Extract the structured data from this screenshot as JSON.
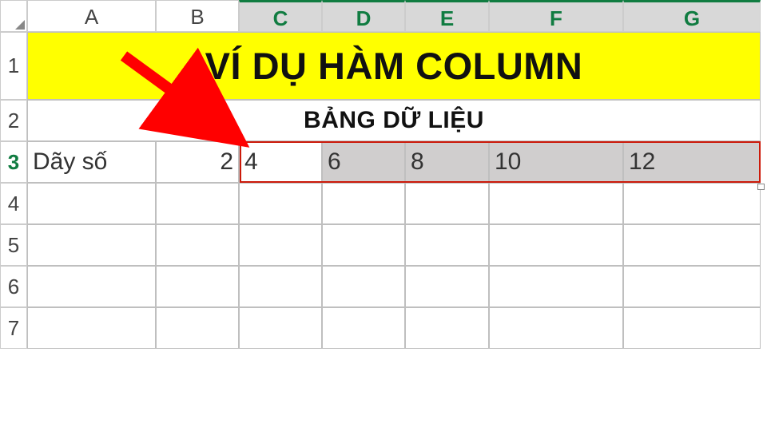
{
  "columns": {
    "A": "A",
    "B": "B",
    "C": "C",
    "D": "D",
    "E": "E",
    "F": "F",
    "G": "G"
  },
  "rows": {
    "r1": "1",
    "r2": "2",
    "r3": "3",
    "r4": "4",
    "r5": "5",
    "r6": "6",
    "r7": "7"
  },
  "row1": {
    "title": "VÍ DỤ HÀM COLUMN"
  },
  "row2": {
    "subtitle": "BẢNG DỮ LIỆU"
  },
  "row3": {
    "A": "Dãy số",
    "B": "2",
    "C": "4",
    "D": "6",
    "E": "8",
    "F": "10",
    "G": "12"
  },
  "chart_data": {
    "type": "table",
    "title": "VÍ DỤ HÀM COLUMN",
    "subtitle": "BẢNG DỮ LIỆU",
    "columns": [
      "A",
      "B",
      "C",
      "D",
      "E",
      "F",
      "G"
    ],
    "rows": [
      {
        "label": "Dãy số",
        "values": [
          2,
          4,
          6,
          8,
          10,
          12
        ]
      }
    ]
  }
}
